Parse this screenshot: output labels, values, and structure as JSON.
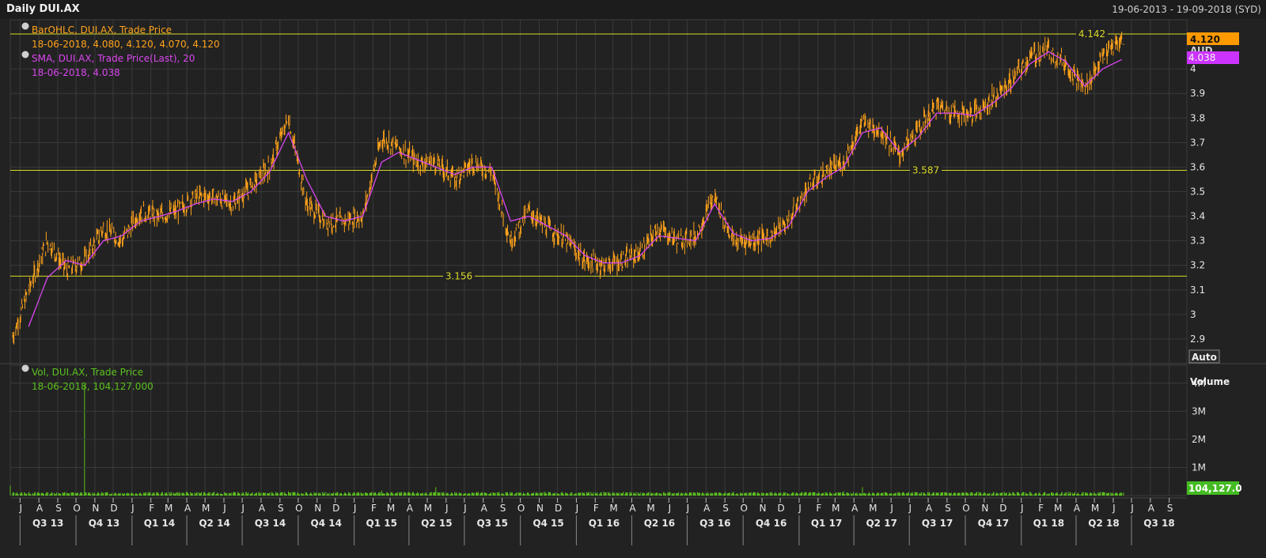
{
  "header": {
    "title": "Daily DUI.AX",
    "date_range": "19-06-2013 - 19-09-2018 (SYD)"
  },
  "legend": {
    "ohlc_label": "BarOHLC, DUI.AX, Trade Price",
    "ohlc_values": "18-06-2018, 4.080, 4.120, 4.070, 4.120",
    "sma_label": "SMA, DUI.AX, Trade Price(Last),  20",
    "sma_values": "18-06-2018, 4.038",
    "vol_label": "Vol, DUI.AX, Trade Price",
    "vol_values": "18-06-2018, 104,127.000"
  },
  "price_axis": {
    "ticks": [
      "4",
      "3.9",
      "3.8",
      "3.7",
      "3.6",
      "3.5",
      "3.4",
      "3.3",
      "3.2",
      "3.1",
      "3",
      "2.9"
    ],
    "currency": "AUD",
    "last_price_tag": "4.120",
    "sma_tag": "4.038",
    "auto_button": "Auto"
  },
  "volume_axis": {
    "title": "Volume",
    "ticks": [
      "4M",
      "3M",
      "2M",
      "1M"
    ],
    "last_volume_tag": "104,127.0"
  },
  "time_axis": {
    "months": [
      "J",
      "A",
      "S",
      "O",
      "N",
      "D",
      "J",
      "F",
      "M",
      "A",
      "M",
      "J",
      "J",
      "A",
      "S",
      "O",
      "N",
      "D",
      "J",
      "F",
      "M",
      "A",
      "M",
      "J",
      "J",
      "A",
      "S",
      "O",
      "N",
      "D",
      "J",
      "F",
      "M",
      "A",
      "M",
      "J",
      "J",
      "A",
      "S",
      "O",
      "N",
      "D",
      "J",
      "F",
      "M",
      "A",
      "M",
      "J",
      "J",
      "A",
      "S",
      "O",
      "N",
      "D",
      "J",
      "F",
      "M",
      "A",
      "M",
      "J",
      "J",
      "A",
      "S"
    ],
    "quarters": [
      "Q3 13",
      "Q4 13",
      "Q1 14",
      "Q2 14",
      "Q3 14",
      "Q4 14",
      "Q1 15",
      "Q2 15",
      "Q3 15",
      "Q4 15",
      "Q1 16",
      "Q2 16",
      "Q3 16",
      "Q4 16",
      "Q1 17",
      "Q2 17",
      "Q3 17",
      "Q4 17",
      "Q1 18",
      "Q2 18",
      "Q3 18"
    ]
  },
  "colors": {
    "background": "#222222",
    "grid": "#3a3a3a",
    "ohlc": "#ffa31a",
    "sma": "#d946ef",
    "volume": "#5cc21f",
    "hline": "#d8d82a",
    "axis_text": "#e6e6e6",
    "price_tag_bg": "#ff9900",
    "sma_tag_bg": "#cc33ff",
    "volume_tag_bg": "#44bb22"
  },
  "chart_data": {
    "type": "line",
    "title": "Daily DUI.AX",
    "x_start": "2013-06-19",
    "x_end": "2018-06-18",
    "ylim": [
      2.8,
      4.2
    ],
    "volume_ylim": [
      0,
      4500000
    ],
    "horizontal_lines": [
      {
        "value": 4.142,
        "label": "4.142"
      },
      {
        "value": 3.587,
        "label": "3.587"
      },
      {
        "value": 3.156,
        "label": "3.156"
      }
    ],
    "series": [
      {
        "name": "BarOHLC, DUI.AX, Trade Price",
        "x": [
          "2013-06",
          "2013-07",
          "2013-08",
          "2013-09",
          "2013-10",
          "2013-11",
          "2013-12",
          "2014-01",
          "2014-02",
          "2014-03",
          "2014-04",
          "2014-05",
          "2014-06",
          "2014-07",
          "2014-08",
          "2014-09",
          "2014-10",
          "2014-11",
          "2014-12",
          "2015-01",
          "2015-02",
          "2015-03",
          "2015-04",
          "2015-05",
          "2015-06",
          "2015-07",
          "2015-08",
          "2015-09",
          "2015-10",
          "2015-11",
          "2015-12",
          "2016-01",
          "2016-02",
          "2016-03",
          "2016-04",
          "2016-05",
          "2016-06",
          "2016-07",
          "2016-08",
          "2016-09",
          "2016-10",
          "2016-11",
          "2016-12",
          "2017-01",
          "2017-02",
          "2017-03",
          "2017-04",
          "2017-05",
          "2017-06",
          "2017-07",
          "2017-08",
          "2017-09",
          "2017-10",
          "2017-11",
          "2017-12",
          "2018-01",
          "2018-02",
          "2018-03",
          "2018-04",
          "2018-05",
          "2018-06"
        ],
        "values": [
          2.88,
          3.1,
          3.3,
          3.18,
          3.22,
          3.35,
          3.3,
          3.42,
          3.4,
          3.42,
          3.48,
          3.48,
          3.45,
          3.52,
          3.6,
          3.8,
          3.45,
          3.38,
          3.38,
          3.4,
          3.72,
          3.68,
          3.62,
          3.62,
          3.55,
          3.62,
          3.58,
          3.3,
          3.42,
          3.35,
          3.3,
          3.22,
          3.2,
          3.22,
          3.25,
          3.35,
          3.3,
          3.32,
          3.48,
          3.3,
          3.3,
          3.32,
          3.38,
          3.52,
          3.58,
          3.62,
          3.78,
          3.75,
          3.65,
          3.75,
          3.85,
          3.82,
          3.82,
          3.88,
          3.95,
          4.05,
          4.08,
          4.02,
          3.92,
          4.05,
          4.12
        ]
      },
      {
        "name": "SMA, DUI.AX, Trade Price(Last),  20",
        "x": [
          "2013-07",
          "2013-08",
          "2013-09",
          "2013-10",
          "2013-11",
          "2013-12",
          "2014-01",
          "2014-02",
          "2014-03",
          "2014-04",
          "2014-05",
          "2014-06",
          "2014-07",
          "2014-08",
          "2014-09",
          "2014-10",
          "2014-11",
          "2014-12",
          "2015-01",
          "2015-02",
          "2015-03",
          "2015-04",
          "2015-05",
          "2015-06",
          "2015-07",
          "2015-08",
          "2015-09",
          "2015-10",
          "2015-11",
          "2015-12",
          "2016-01",
          "2016-02",
          "2016-03",
          "2016-04",
          "2016-05",
          "2016-06",
          "2016-07",
          "2016-08",
          "2016-09",
          "2016-10",
          "2016-11",
          "2016-12",
          "2017-01",
          "2017-02",
          "2017-03",
          "2017-04",
          "2017-05",
          "2017-06",
          "2017-07",
          "2017-08",
          "2017-09",
          "2017-10",
          "2017-11",
          "2017-12",
          "2018-01",
          "2018-02",
          "2018-03",
          "2018-04",
          "2018-05",
          "2018-06"
        ],
        "values": [
          2.95,
          3.15,
          3.22,
          3.2,
          3.3,
          3.32,
          3.38,
          3.4,
          3.42,
          3.45,
          3.47,
          3.46,
          3.5,
          3.58,
          3.74,
          3.55,
          3.4,
          3.38,
          3.4,
          3.62,
          3.66,
          3.63,
          3.6,
          3.57,
          3.6,
          3.6,
          3.38,
          3.4,
          3.36,
          3.32,
          3.24,
          3.21,
          3.21,
          3.24,
          3.32,
          3.31,
          3.3,
          3.45,
          3.33,
          3.3,
          3.31,
          3.36,
          3.5,
          3.56,
          3.6,
          3.74,
          3.76,
          3.66,
          3.72,
          3.82,
          3.82,
          3.81,
          3.86,
          3.92,
          4.02,
          4.07,
          4.03,
          3.93,
          4.0,
          4.038
        ]
      },
      {
        "name": "Vol, DUI.AX, Trade Price",
        "x": [
          "2013-06",
          "2013-10",
          "2014-03",
          "2014-09",
          "2015-02",
          "2015-05",
          "2016-02",
          "2016-09",
          "2017-03",
          "2017-04",
          "2018-01",
          "2018-06"
        ],
        "values": [
          350000,
          3950000,
          120000,
          150000,
          180000,
          300000,
          140000,
          130000,
          150000,
          300000,
          140000,
          104127
        ]
      }
    ]
  }
}
